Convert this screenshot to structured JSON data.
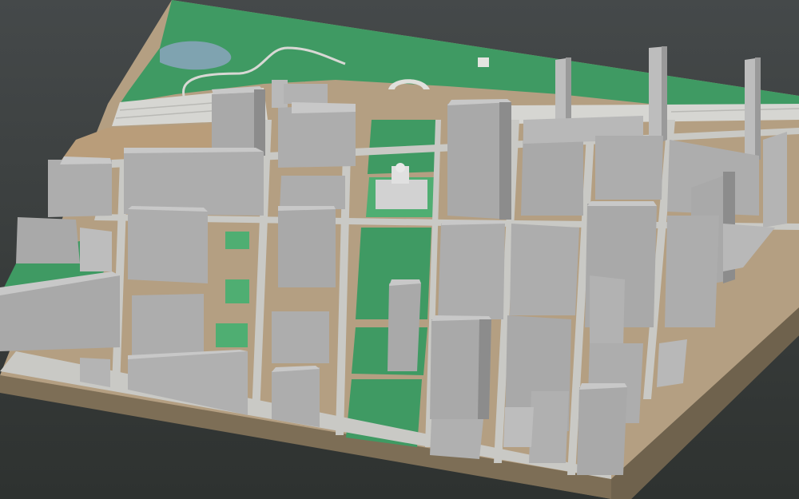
{
  "scene": {
    "kind": "3d-city-block-model",
    "colors": {
      "background_top": "#3f4340",
      "background_bottom": "#2f3331",
      "base_side": "#7a6c56",
      "base_front": "#8a7a60",
      "ground": "#b49f82",
      "road": "#c9c9c5",
      "park": "#3f9a63",
      "park_light": "#4fae72",
      "water": "#7fa3b0",
      "building_top": "#c8c8c8",
      "building_side": "#a9a9a9",
      "building_shadow": "#8c8c8c",
      "railway": "#d6d6d2",
      "dirt": "#b99d7a"
    }
  }
}
